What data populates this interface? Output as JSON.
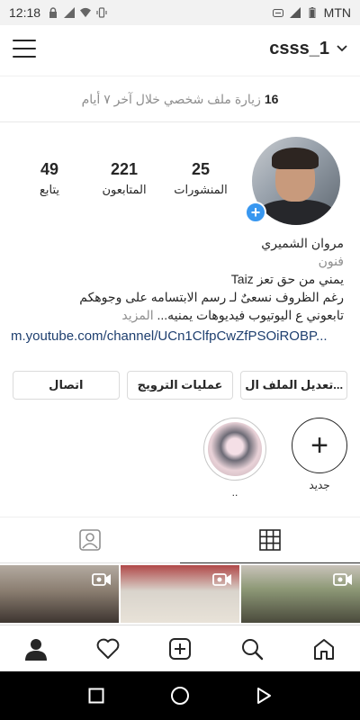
{
  "status_bar": {
    "time": "12:18",
    "carrier": "MTN",
    "icons": [
      "lock-icon",
      "signal-icon",
      "wifi-icon",
      "vibrate-icon",
      "vpn-icon",
      "signal-icon",
      "battery-icon"
    ]
  },
  "header": {
    "username": "csss_1",
    "menu_icon": "hamburger-icon",
    "dropdown_icon": "chevron-down-icon"
  },
  "visits": {
    "count": "16",
    "text": "زيارة ملف شخصي خلال آخر ٧ أيام"
  },
  "stats": {
    "posts": {
      "value": "25",
      "label": "المنشورات"
    },
    "followers": {
      "value": "221",
      "label": "المتابعون"
    },
    "following": {
      "value": "49",
      "label": "يتابع"
    }
  },
  "bio": {
    "name": "مروان الشميري",
    "category": "فنون",
    "line1": "يمني من حق تعز Taiz",
    "line2": "رغم الظروف نسعىٌ لـ رسم الابتسامه على وجوهكم",
    "line3": "تابعوني ع اليوتيوب فيديوهات يمنيه...",
    "more": "المزيد",
    "link": "m.youtube.com/channel/UCn1ClfpCwZfPSOiROBP..."
  },
  "buttons": {
    "edit_profile": "تعديل الملف ال...",
    "promotions": "عمليات الترويج",
    "contact": "اتصال"
  },
  "highlights": [
    {
      "label": "جديد",
      "type": "new"
    },
    {
      "label": "..",
      "type": "story"
    }
  ],
  "tabs": [
    {
      "name": "grid",
      "icon": "grid-icon",
      "active": true
    },
    {
      "name": "tagged",
      "icon": "tagged-person-icon",
      "active": false
    }
  ],
  "bottom_nav": [
    "home-icon",
    "search-icon",
    "add-post-icon",
    "heart-icon",
    "profile-icon"
  ],
  "android_nav": [
    "back-icon",
    "home-circle-icon",
    "recents-icon"
  ],
  "colors": {
    "accent": "#3897f0",
    "link": "#1e3f6f",
    "secondary_text": "#8e8e8e",
    "border": "#dbdbdb"
  }
}
